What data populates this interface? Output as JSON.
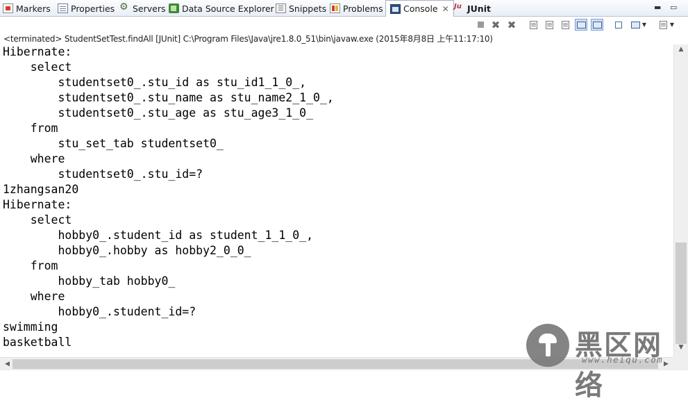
{
  "tabs": [
    {
      "label": "Markers",
      "icon": "markers-icon"
    },
    {
      "label": "Properties",
      "icon": "properties-icon"
    },
    {
      "label": "Servers",
      "icon": "servers-icon"
    },
    {
      "label": "Data Source Explorer",
      "icon": "data-source-explorer-icon"
    },
    {
      "label": "Snippets",
      "icon": "snippets-icon"
    },
    {
      "label": "Problems",
      "icon": "problems-icon"
    },
    {
      "label": "Console",
      "icon": "console-icon",
      "active": true,
      "close": "✕"
    },
    {
      "label": "JUnit",
      "icon": "junit-icon"
    }
  ],
  "window_controls": {
    "minimize": "▬",
    "maximize": "▭"
  },
  "status_line": "<terminated> StudentSetTest.findAll [JUnit] C:\\Program Files\\Java\\jre1.8.0_51\\bin\\javaw.exe (2015年8月8日 上午11:17:10)",
  "console_lines": [
    "Hibernate: ",
    "    select",
    "        studentset0_.stu_id as stu_id1_1_0_,",
    "        studentset0_.stu_name as stu_name2_1_0_,",
    "        studentset0_.stu_age as stu_age3_1_0_ ",
    "    from",
    "        stu_set_tab studentset0_ ",
    "    where",
    "        studentset0_.stu_id=?",
    "1zhangsan20",
    "Hibernate: ",
    "    select",
    "        hobby0_.student_id as student_1_1_0_,",
    "        hobby0_.hobby as hobby2_0_0_ ",
    "    from",
    "        hobby_tab hobby0_ ",
    "    where",
    "        hobby0_.student_id=?",
    "swimming",
    "basketball"
  ],
  "watermark": {
    "name": "黑区网络",
    "url": "www.heiqu.com"
  },
  "colors": {
    "tabbar_bg": "#e9eef6",
    "pressed_button": "#cfe0f5",
    "text": "#000000"
  }
}
